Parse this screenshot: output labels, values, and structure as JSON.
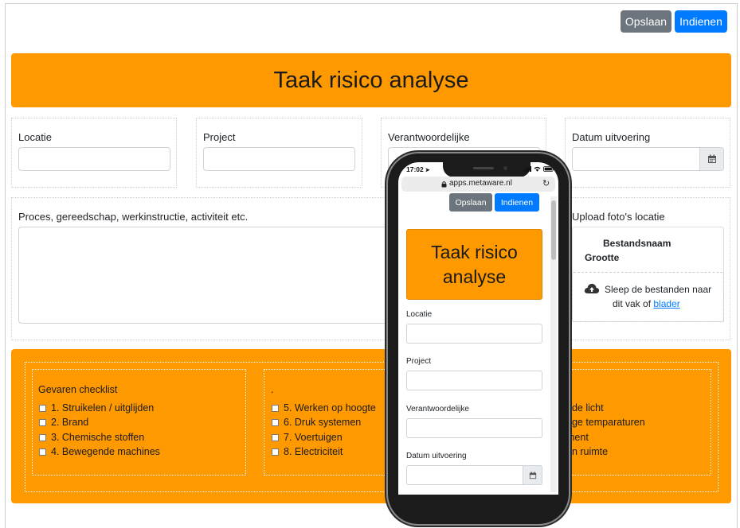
{
  "toolbar": {
    "save_label": "Opslaan",
    "submit_label": "Indienen"
  },
  "form": {
    "title": "Taak risico analyse",
    "fields": {
      "location": {
        "label": "Locatie",
        "value": ""
      },
      "project": {
        "label": "Project",
        "value": ""
      },
      "responsible": {
        "label": "Verantwoordelijke",
        "value": ""
      },
      "date": {
        "label": "Datum uitvoering",
        "value": ""
      }
    },
    "process": {
      "label": "Proces, gereedschap, werkinstructie, activiteit etc.",
      "value": ""
    },
    "upload": {
      "label": "Upload foto's locatie",
      "col_filename": "Bestandsnaam",
      "col_size": "Grootte",
      "drop_text_1": "Sleep de bestanden naar",
      "drop_text_2": "dit vak of",
      "browse_link": "blader"
    },
    "checklist": {
      "title": "Gevaren checklist",
      "col2_title": ".",
      "col1": [
        "1. Struikelen / uitglijden",
        "2. Brand",
        "3. Chemische stoffen",
        "4. Bewegende machines"
      ],
      "col2": [
        "5. Werken op hoogte",
        "6. Druk systemen",
        "7. Voertuigen",
        "8. Electriciteit"
      ],
      "col3_partial": [
        "nde licht",
        "oge temparaturen",
        "ment",
        "en ruimte"
      ]
    }
  },
  "phone": {
    "time": "17:02",
    "url": "apps.metaware.nl",
    "save_label": "Opslaan",
    "submit_label": "Indienen",
    "title_line1": "Taak risico",
    "title_line2": "analyse",
    "fields": [
      "Locatie",
      "Project",
      "Verantwoordelijke",
      "Datum uitvoering"
    ]
  },
  "colors": {
    "accent_orange": "#ff9900",
    "primary_blue": "#007bff",
    "secondary_gray": "#6c757d"
  },
  "icons": [
    "calendar-icon",
    "cloud-upload-icon",
    "lock-icon",
    "reload-icon",
    "signal-icon",
    "wifi-icon",
    "battery-icon",
    "location-arrow-icon"
  ]
}
